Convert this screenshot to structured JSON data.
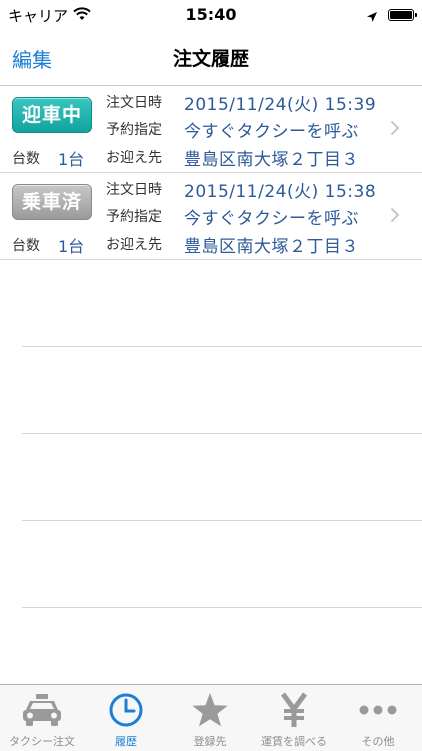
{
  "status_bar": {
    "carrier": "キャリア",
    "time": "15:40"
  },
  "nav": {
    "edit_label": "編集",
    "title": "注文履歴"
  },
  "labels": {
    "order_time": "注文日時",
    "reservation": "予約指定",
    "pickup": "お迎え先",
    "count": "台数"
  },
  "orders": [
    {
      "status": "迎車中",
      "status_color": "#1aa9a4",
      "datetime": "2015/11/24(火) 15:39",
      "reservation": "今すぐタクシーを呼ぶ",
      "pickup": "豊島区南大塚２丁目３",
      "count": "1台"
    },
    {
      "status": "乗車済",
      "status_color": "#a4a4a4",
      "datetime": "2015/11/24(火) 15:38",
      "reservation": "今すぐタクシーを呼ぶ",
      "pickup": "豊島区南大塚２丁目３",
      "count": "1台"
    }
  ],
  "tabs": [
    {
      "label": "タクシー注文",
      "icon": "taxi-icon",
      "selected": false
    },
    {
      "label": "履歴",
      "icon": "clock-icon",
      "selected": true
    },
    {
      "label": "登録先",
      "icon": "star-icon",
      "selected": false
    },
    {
      "label": "運賃を調べる",
      "icon": "yen-icon",
      "selected": false
    },
    {
      "label": "その他",
      "icon": "more-icon",
      "selected": false
    }
  ],
  "colors": {
    "accent": "#1c7fd6",
    "value_text": "#2d5a9a",
    "inactive_tab": "#8e8e8e"
  }
}
